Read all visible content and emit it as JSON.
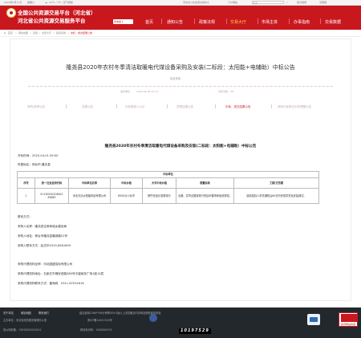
{
  "topbar": {
    "date": "2020年4月11日",
    "weekday": "星期六",
    "weather": "12℃~7℃ | 空气质量",
    "links": [
      "河北省公共资源交易中心",
      "门户网站"
    ],
    "search_placeholder": "搜索",
    "sub_links": [
      "官方微博",
      "无障碍"
    ]
  },
  "header": {
    "title_line1": "全国公共资源交易平台（河北省）",
    "title_line2": "河北省公共资源交易服务平台",
    "region": "省本级 ▾",
    "nav": [
      "首页",
      "通知公告",
      "政策法规",
      "交易大厅",
      "市场主体",
      "办事指南",
      "交易数据"
    ],
    "active_nav_index": 3
  },
  "breadcrumb": {
    "items": [
      "首页",
      "网站地图",
      "县级",
      "交易大厅",
      "政府采购",
      "中标、成交结果公告"
    ],
    "separator": "»",
    "current_index": 5
  },
  "article": {
    "title": "隆尧县2020年农村冬季清洁取暖电代煤设备采购及安装(二标段：太阳能+电辅助）中标公告",
    "source": "信息来源：",
    "meta": {
      "publisher": "发布单位",
      "date": "2020-04-08 14:13",
      "views": "浏览次数：48"
    },
    "tabs": [
      "采购/资审公告",
      "变更公告",
      "中标候选人公示",
      "变更结果公告",
      "中标、成交结果公告",
      "采购中标单位中标提醒公告"
    ],
    "active_tab_index": 4
  },
  "doc": {
    "title": "隆尧县2020年农村冬季清洁取暖电代煤设备采购及安装(二标段：太阳能+电辅助）中标公告",
    "open_time": "开标时间：2020-04-01 09:00",
    "area": "所属地区：邢台市-隆尧县",
    "table": {
      "section_header": "中标单位",
      "headers": [
        "序号",
        "统一社会信用代码",
        "中标单位名称",
        "中标价格",
        "大写中标价格",
        "质量标准",
        "工期/交货期"
      ],
      "rows": [
        [
          "1",
          "91130500108047 8388Y",
          "河北光清太阳能科技有限公司",
          "8500元人民币",
          "捌仟伍佰元零角零分",
          "合格，并符合国家现行的技术要求和验收规范。",
          "接到招标人供货通知后60天内完成供货及安装调试。"
        ]
      ]
    },
    "contact_header": "联系方式：",
    "contacts": [
      "采购人名称：隆尧县住房和城乡建设局",
      "采购人地址：邢台市隆尧县隆城路52号",
      "采购人联系方式：赵志华0319-6561699",
      "采购代理机构全称：河北国盛招标有限公司",
      "采购代理机构地址：石家庄市槐安西路380号平堰商务广场1座14层",
      "采购代理机构联系方式：董海珠　0311-87031616"
    ]
  },
  "footer": {
    "links": [
      "关于本站",
      "网站地图",
      "联系我们"
    ],
    "note": "建议使用1366*768分辨率/IE9.0版以上浏览器访问本网站获取最佳体验",
    "sponsor": "主办单位：河北省政务服务管理办公室",
    "icp": "冀ICP备14022324号",
    "police": "冀公网安备：13020502001611",
    "site_id": "网站标识码：1300000074",
    "counter": "10197529",
    "badge_label": "政府网站找错"
  },
  "colors": {
    "brand": "#c9171e",
    "highlight": "#ffd24a",
    "footer_bg": "#23282d"
  }
}
